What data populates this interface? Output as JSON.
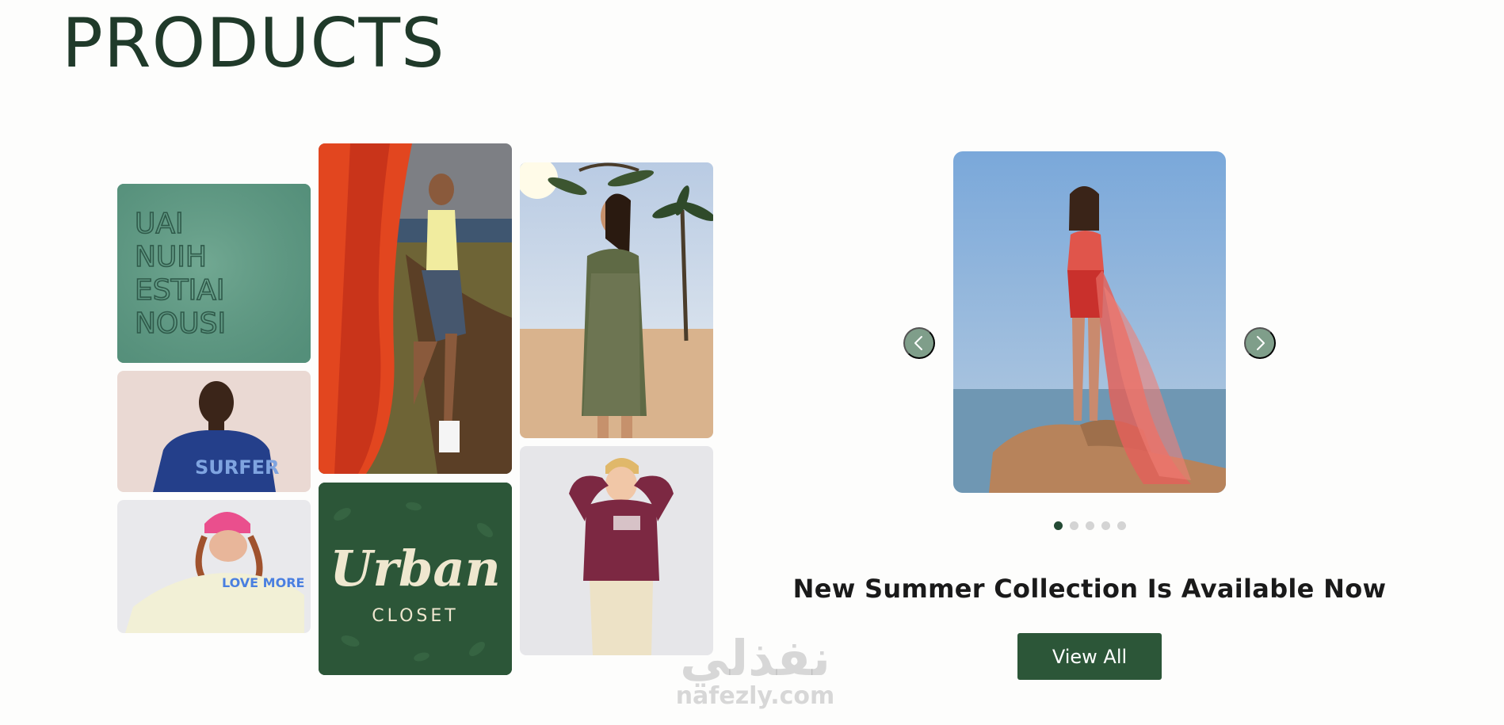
{
  "page": {
    "title": "PRODUCTS"
  },
  "gallery": {
    "tiles": [
      {
        "name": "neon-sign-tile",
        "alt": "Neon wall sign",
        "neon_lines": [
          "UAI",
          "NUIH",
          "ESTIAI",
          "NOUSI"
        ]
      },
      {
        "name": "man-blue-tshirt-tile",
        "alt": "Man in blue t-shirt",
        "shirt_text": "SURFER"
      },
      {
        "name": "woman-pink-beanie-tile",
        "alt": "Woman in pink beanie",
        "sweater_text": "LOVE MORE"
      },
      {
        "name": "man-red-wall-tile",
        "alt": "Man leaning on red wall"
      },
      {
        "name": "urban-closet-logo-tile",
        "alt": "Urban Closet logo",
        "logo_main": "Urban",
        "logo_sub": "CLOSET"
      },
      {
        "name": "woman-beach-dress-tile",
        "alt": "Woman in patterned dress at beach"
      },
      {
        "name": "child-burgundy-tile",
        "alt": "Child in burgundy top"
      }
    ]
  },
  "carousel": {
    "slide_alt": "Woman in red swimsuit with flowing scarf by the sea",
    "prev_label": "Previous slide",
    "next_label": "Next slide",
    "slide_count": 5,
    "active_index": 0,
    "headline": "New Summer Collection Is Available Now",
    "cta_label": "View All"
  },
  "watermark": {
    "arabic": "نفذلي",
    "latin": "nafezly.com"
  },
  "colors": {
    "brand_green": "#2c5638",
    "title_green": "#203a2a",
    "arrow_bg": "#7f9e8a",
    "dot_active": "#244a34",
    "dot_inactive": "#d4d4d4"
  }
}
